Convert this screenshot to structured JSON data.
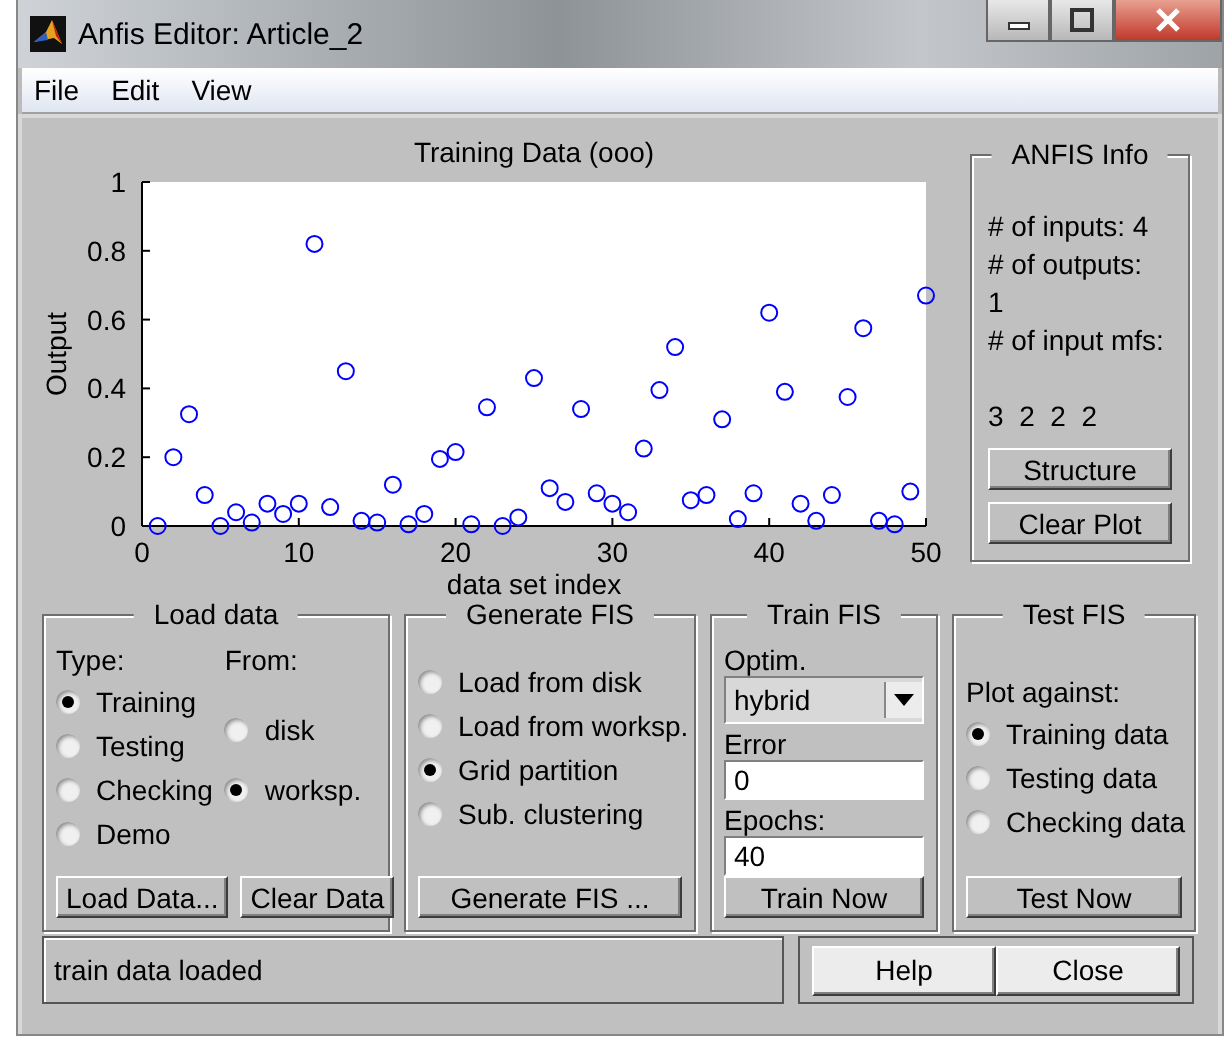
{
  "window": {
    "title": "Anfis Editor: Article_2"
  },
  "menu": [
    "File",
    "Edit",
    "View"
  ],
  "plot": {
    "chart_data": {
      "type": "scatter",
      "title": "Training Data (ooo)",
      "xlabel": "data set index",
      "ylabel": "Output",
      "x": [
        1,
        2,
        3,
        4,
        5,
        6,
        7,
        8,
        9,
        10,
        11,
        12,
        13,
        14,
        15,
        16,
        17,
        18,
        19,
        20,
        21,
        22,
        23,
        24,
        25,
        26,
        27,
        28,
        29,
        30,
        31,
        32,
        33,
        34,
        35,
        36,
        37,
        38,
        39,
        40,
        41,
        42,
        43,
        44,
        45,
        46,
        47,
        48,
        49,
        50
      ],
      "values": [
        0.0,
        0.2,
        0.325,
        0.09,
        0.0,
        0.04,
        0.01,
        0.065,
        0.035,
        0.065,
        0.82,
        0.055,
        0.45,
        0.015,
        0.01,
        0.12,
        0.005,
        0.035,
        0.195,
        0.215,
        0.005,
        0.345,
        0.0,
        0.025,
        0.43,
        0.11,
        0.07,
        0.34,
        0.095,
        0.065,
        0.04,
        0.225,
        0.395,
        0.52,
        0.075,
        0.09,
        0.31,
        0.02,
        0.095,
        0.62,
        0.39,
        0.065,
        0.015,
        0.09,
        0.375,
        0.575,
        0.015,
        0.005,
        0.1,
        0.67
      ],
      "xlim": [
        0,
        50
      ],
      "ylim": [
        0,
        1
      ],
      "xticks": [
        0,
        10,
        20,
        30,
        40,
        50
      ],
      "yticks": [
        0,
        0.2,
        0.4,
        0.6,
        0.8,
        1
      ]
    }
  },
  "anfis_info": {
    "title": "ANFIS Info",
    "lines": [
      "# of inputs: 4",
      "# of outputs:",
      "1",
      "# of input mfs:",
      "3  2  2  2"
    ],
    "buttons": [
      "Structure",
      "Clear Plot"
    ]
  },
  "load_data": {
    "title": "Load data",
    "type_label": "Type:",
    "from_label": "From:",
    "types": [
      {
        "label": "Training",
        "selected": true
      },
      {
        "label": "Testing",
        "selected": false
      },
      {
        "label": "Checking",
        "selected": false
      },
      {
        "label": "Demo",
        "selected": false
      }
    ],
    "sources": [
      {
        "label": "disk",
        "selected": false
      },
      {
        "label": "worksp.",
        "selected": true
      }
    ],
    "buttons": [
      "Load Data...",
      "Clear Data"
    ]
  },
  "generate_fis": {
    "title": "Generate FIS",
    "options": [
      {
        "label": "Load from disk",
        "selected": false
      },
      {
        "label": "Load from worksp.",
        "selected": false
      },
      {
        "label": "Grid partition",
        "selected": true
      },
      {
        "label": "Sub. clustering",
        "selected": false
      }
    ],
    "button": "Generate FIS ..."
  },
  "train_fis": {
    "title": "Train FIS",
    "optim_label": "Optim.",
    "optim_value": "hybrid",
    "error_label": "Error",
    "error_value": "0",
    "epochs_label": "Epochs:",
    "epochs_value": "40",
    "button": "Train Now"
  },
  "test_fis": {
    "title": "Test FIS",
    "plot_label": "Plot against:",
    "options": [
      {
        "label": "Training data",
        "selected": true
      },
      {
        "label": "Testing data",
        "selected": false
      },
      {
        "label": "Checking data",
        "selected": false
      }
    ],
    "button": "Test Now"
  },
  "status": "train data loaded",
  "buttons": [
    "Help",
    "Close"
  ]
}
